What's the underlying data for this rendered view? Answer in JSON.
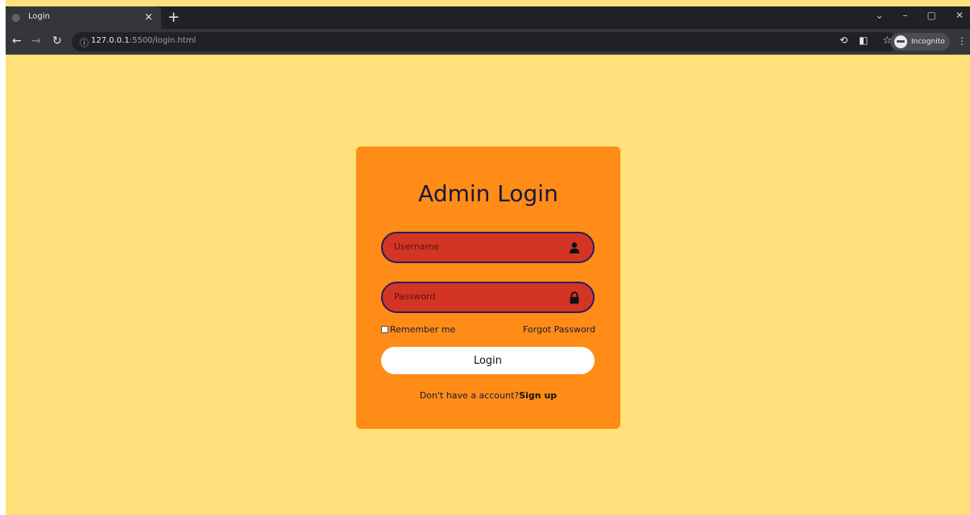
{
  "browser": {
    "tab_title": "Login",
    "tab_close": "×",
    "new_tab": "+",
    "url_host": "127.0.0.1",
    "url_rest": ":5500/login.html",
    "incognito_label": "Incognito",
    "controls": {
      "dropdown": "⌄",
      "minimize": "–",
      "restore": "▢",
      "close": "✕"
    }
  },
  "login": {
    "title": "Admin Login",
    "username_placeholder": "Username",
    "password_placeholder": "Password",
    "remember_label": "Remember me",
    "forgot_label": "Forgot Password",
    "login_button": "Login",
    "signup_prompt": "Don't have a account?",
    "signup_link": "Sign up"
  },
  "colors": {
    "page_bg": "#ffe07a",
    "card_bg": "#fe8c16",
    "field_bg": "#d33524",
    "field_border": "#2a1a63",
    "title_color": "#1a1640"
  },
  "icons": {
    "username": "user-icon",
    "password": "lock-icon"
  }
}
